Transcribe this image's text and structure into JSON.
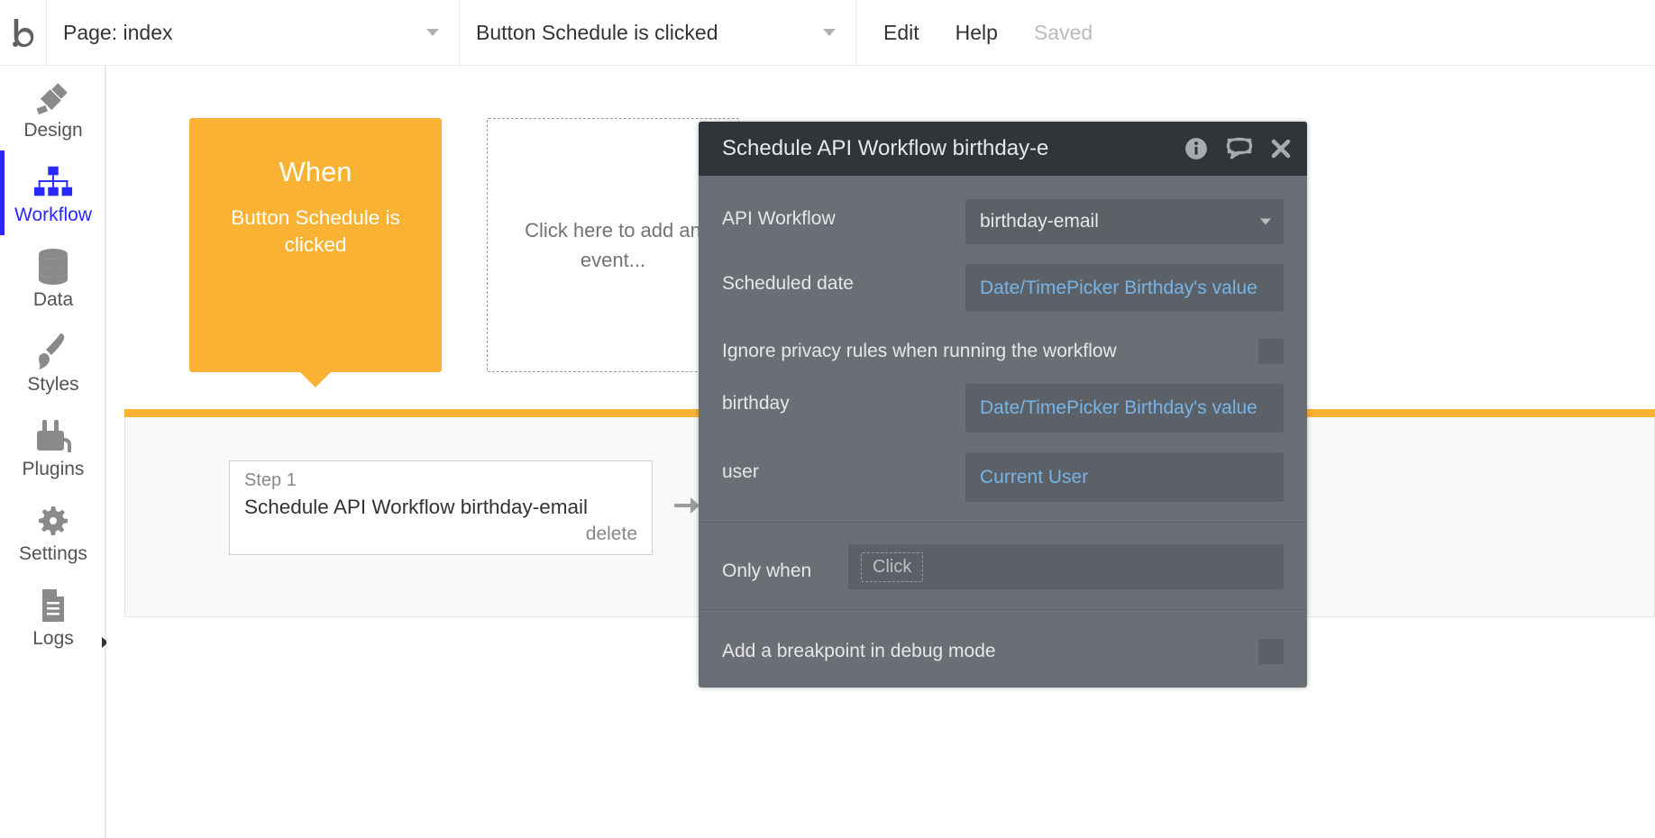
{
  "topbar": {
    "page_dropdown": "Page: index",
    "element_dropdown": "Button Schedule is clicked",
    "edit": "Edit",
    "help": "Help",
    "saved": "Saved"
  },
  "sidebar": {
    "items": [
      {
        "label": "Design"
      },
      {
        "label": "Workflow"
      },
      {
        "label": "Data"
      },
      {
        "label": "Styles"
      },
      {
        "label": "Plugins"
      },
      {
        "label": "Settings"
      },
      {
        "label": "Logs"
      }
    ]
  },
  "event_card": {
    "title": "When",
    "desc": "Button Schedule is clicked"
  },
  "add_event": "Click here to add an event...",
  "step": {
    "num": "Step 1",
    "title": "Schedule API Workflow birthday-email",
    "delete": "delete"
  },
  "panel": {
    "title": "Schedule API Workflow birthday-e",
    "rows": {
      "api_workflow_label": "API Workflow",
      "api_workflow_value": "birthday-email",
      "scheduled_date_label": "Scheduled date",
      "scheduled_date_value": "Date/TimePicker Birthday's value",
      "ignore_privacy_label": "Ignore privacy rules when running the workflow",
      "birthday_label": "birthday",
      "birthday_value": "Date/TimePicker Birthday's value",
      "user_label": "user",
      "user_value": "Current User",
      "only_when_label": "Only when",
      "only_when_chip": "Click",
      "breakpoint_label": "Add a breakpoint in debug mode"
    }
  }
}
